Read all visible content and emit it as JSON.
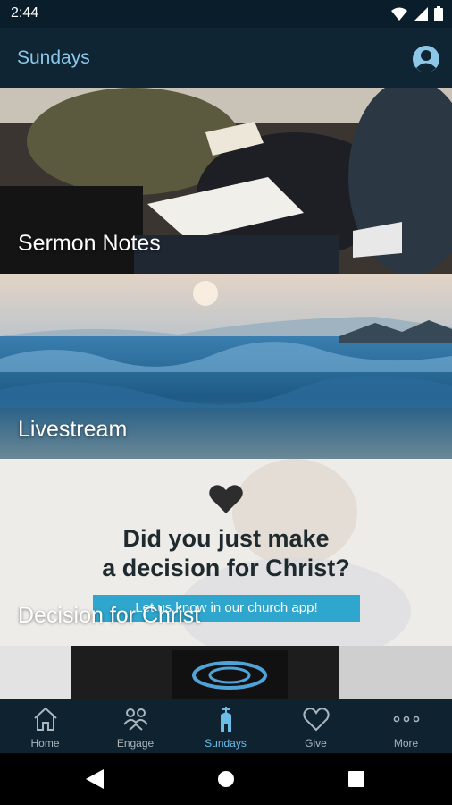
{
  "status_bar": {
    "time": "2:44"
  },
  "app_bar": {
    "title": "Sundays"
  },
  "cards": [
    {
      "label": "Sermon Notes"
    },
    {
      "label": "Livestream"
    },
    {
      "label": "Decision for Christ"
    }
  ],
  "promo": {
    "line1": "Did you just make",
    "line2": "a decision for Christ?",
    "banner": "Let us know in our church app!"
  },
  "bottom_nav": [
    {
      "label": "Home",
      "icon": "home-icon"
    },
    {
      "label": "Engage",
      "icon": "people-icon"
    },
    {
      "label": "Sundays",
      "icon": "church-icon"
    },
    {
      "label": "Give",
      "icon": "heart-icon"
    },
    {
      "label": "More",
      "icon": "more-icon"
    }
  ],
  "colors": {
    "app_bar": "#0f2533",
    "title": "#8cc7e8",
    "active_nav": "#6bbde8",
    "banner": "#2fa6cd"
  }
}
